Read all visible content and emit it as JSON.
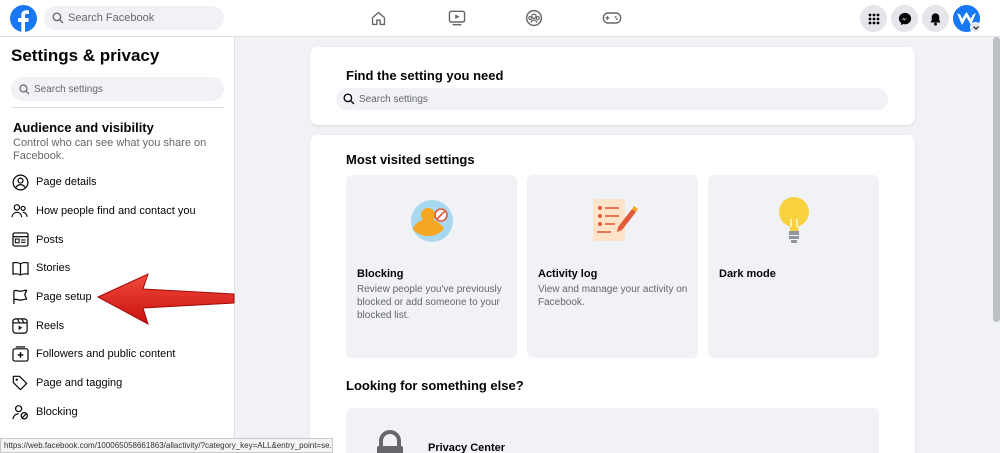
{
  "topbar": {
    "search_placeholder": "Search Facebook",
    "nav_icons": [
      "home-icon",
      "watch-icon",
      "groups-icon",
      "gaming-icon"
    ],
    "right_icons": [
      "menu-grid-icon",
      "messenger-icon",
      "notifications-icon"
    ]
  },
  "sidebar": {
    "title": "Settings & privacy",
    "search_placeholder": "Search settings",
    "section_title": "Audience and visibility",
    "section_desc": "Control who can see what you share on Facebook.",
    "items": [
      {
        "label": "Page details",
        "icon": "person-circle-icon"
      },
      {
        "label": "How people find and contact you",
        "icon": "people-icon"
      },
      {
        "label": "Posts",
        "icon": "posts-icon"
      },
      {
        "label": "Stories",
        "icon": "stories-icon"
      },
      {
        "label": "Page setup",
        "icon": "flag-icon"
      },
      {
        "label": "Reels",
        "icon": "reels-icon"
      },
      {
        "label": "Followers and public content",
        "icon": "followers-icon"
      },
      {
        "label": "Page and tagging",
        "icon": "tag-icon"
      },
      {
        "label": "Blocking",
        "icon": "blocking-icon"
      }
    ]
  },
  "status_url": "https://web.facebook.com/100065058661863/allactivity/?category_key=ALL&entry_point=se...",
  "main": {
    "find_title": "Find the setting you need",
    "find_placeholder": "Search settings",
    "most_visited_title": "Most visited settings",
    "tiles": [
      {
        "title": "Blocking",
        "desc": "Review people you've previously blocked or add someone to your blocked list."
      },
      {
        "title": "Activity log",
        "desc": "View and manage your activity on Facebook."
      },
      {
        "title": "Dark mode",
        "desc": ""
      }
    ],
    "looking_title": "Looking for something else?",
    "privacy_center": "Privacy Center"
  },
  "colors": {
    "brand": "#1877f2",
    "annotation_arrow": "#e8201c"
  }
}
